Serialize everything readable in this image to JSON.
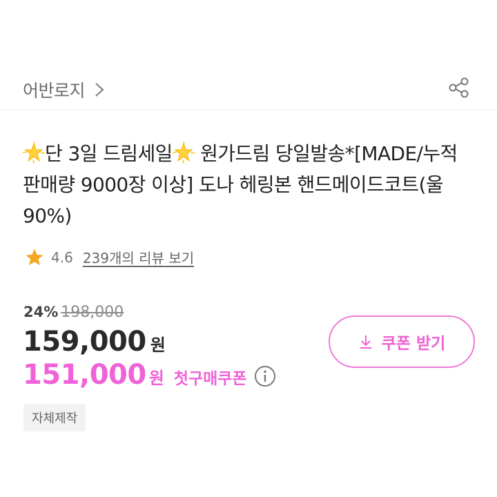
{
  "store": {
    "name": "어반로지"
  },
  "product": {
    "title_lines": [
      {
        "segments": [
          "",
          "단 3일 드림세일",
          " 원가드림 당일발송*[MADE/누적"
        ]
      },
      "판매량 9000장 이상] 도나 헤링본 핸드메이드코트(울",
      "90%)"
    ]
  },
  "rating": {
    "value": "4.6",
    "reviews_label": "239개의 리뷰 보기"
  },
  "pricing": {
    "discount_percent": "24%",
    "original_price": "198,000",
    "sale_price": "159,000",
    "currency": "원",
    "coupon_price": "151,000",
    "coupon_currency": "원",
    "coupon_type": "첫구매쿠폰"
  },
  "coupon_button": {
    "label": "쿠폰 받기"
  },
  "tags": [
    "자체제작"
  ],
  "icons": {
    "chevron": "chevron-right-icon",
    "share": "share-icon",
    "sparkle": "glowing-star-icon",
    "star": "star-icon",
    "info": "info-icon",
    "download": "download-icon"
  },
  "colors": {
    "accent_pink": "#f062d8",
    "star": "#f5a623",
    "text_primary": "#222222",
    "text_muted": "#6b6b6b"
  }
}
